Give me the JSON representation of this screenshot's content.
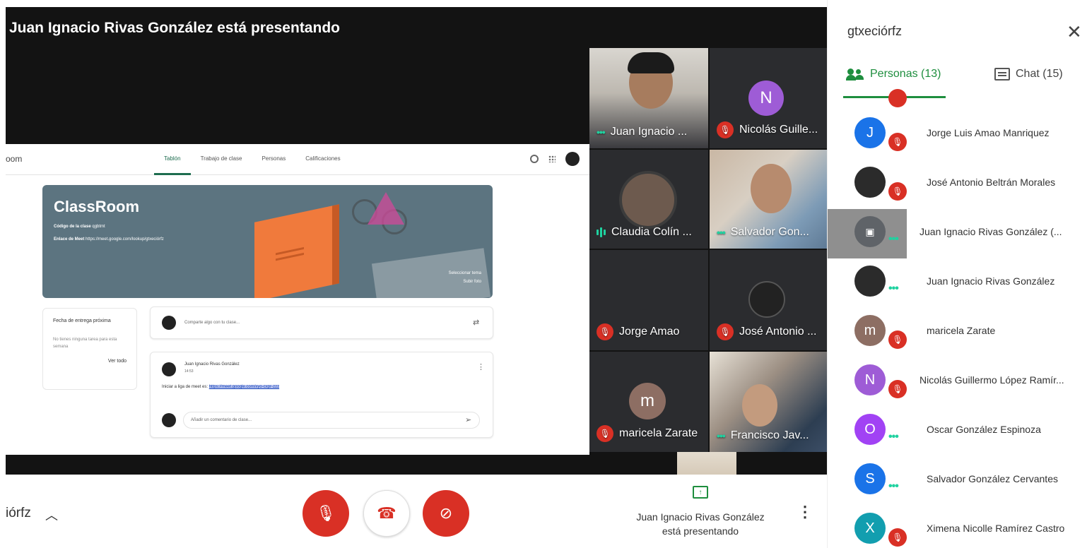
{
  "stage": {
    "presenting_title": "Juan Ignacio Rivas González está presentando"
  },
  "classroom": {
    "brand": "oom",
    "tabs": [
      {
        "label": "Tablón",
        "active": true
      },
      {
        "label": "Trabajo de clase",
        "active": false
      },
      {
        "label": "Personas",
        "active": false
      },
      {
        "label": "Calificaciones",
        "active": false
      }
    ],
    "banner_title": "ClassRoom",
    "class_code_label": "Código de la clase",
    "class_code": "qgbtmt",
    "meet_link_label": "Enlace de Meet",
    "meet_link": "https://meet.google.com/lookup/gtxeciórfz",
    "select_theme": "Seleccionar tema",
    "upload_photo": "Subir foto",
    "due_title": "Fecha de entrega próxima",
    "due_text": "No tienes ninguna tarea para esta semana",
    "view_all": "Ver todo",
    "share_placeholder": "Comparte algo con tu clase...",
    "post_author": "Juan Ignacio Rivas González",
    "post_time": "14:53",
    "post_text": "Iniciar a liga de meet es:",
    "post_link": "https://meet.google.com/xyo-cxpr-zzz",
    "comment_placeholder": "Añadir un comentario de clase..."
  },
  "tiles": [
    {
      "name": "Juan Ignacio ...",
      "state": "speaking-dots"
    },
    {
      "name": "Nicolás Guille...",
      "state": "muted",
      "initial": "N",
      "color": "#9e5cd6"
    },
    {
      "name": "Claudia Colín ...",
      "state": "speaking-bars"
    },
    {
      "name": "Salvador Gon...",
      "state": "speaking-dots"
    },
    {
      "name": "Jorge Amao",
      "state": "muted"
    },
    {
      "name": "José Antonio ...",
      "state": "muted"
    },
    {
      "name": "maricela Zarate",
      "state": "muted",
      "initial": "m",
      "color": "#8d6e63"
    },
    {
      "name": "Francisco Jav...",
      "state": "speaking-dots"
    }
  ],
  "panel": {
    "title": "gtxeciórfz",
    "tab_people": "Personas (13)",
    "tab_chat": "Chat (15)",
    "participants": [
      {
        "name": "Jorge Luis Amao Manriquez",
        "initial": "J",
        "color": "#1a73e8",
        "state": "muted"
      },
      {
        "name": "José Antonio Beltrán Morales",
        "initial": "",
        "color": "#2b2b2b",
        "state": "muted"
      },
      {
        "name": "Juan Ignacio Rivas González (...",
        "initial": "",
        "color": "#5f6368",
        "state": "presenting"
      },
      {
        "name": "Juan Ignacio Rivas González",
        "initial": "",
        "color": "#2b2b2b",
        "state": "dots"
      },
      {
        "name": "maricela Zarate",
        "initial": "m",
        "color": "#8d6e63",
        "state": "muted"
      },
      {
        "name": "Nicolás Guillermo López Ramír...",
        "initial": "N",
        "color": "#9e5cd6",
        "state": "muted"
      },
      {
        "name": "Oscar González Espinoza",
        "initial": "O",
        "color": "#a142f4",
        "state": "dots"
      },
      {
        "name": "Salvador González Cervantes",
        "initial": "S",
        "color": "#1a73e8",
        "state": "dots"
      },
      {
        "name": "Ximena Nicolle Ramírez Castro",
        "initial": "X",
        "color": "#129eaf",
        "state": "muted"
      }
    ]
  },
  "bottom": {
    "meeting_code": "iórfz",
    "presenting_line1": "Juan Ignacio Rivas González",
    "presenting_line2": "está presentando"
  },
  "icons": {
    "mic": "mic-off-icon",
    "hangup": "call-end-icon",
    "camera": "videocam-off-icon",
    "present": "present-to-all-icon",
    "more": "more-vert-icon",
    "close": "close-icon",
    "people": "people-icon",
    "chat": "chat-icon"
  },
  "colors": {
    "accent": "#1e8e3e",
    "danger": "#d93025",
    "active_speaker": "#1fd2a0",
    "stage_bg": "#131313"
  }
}
